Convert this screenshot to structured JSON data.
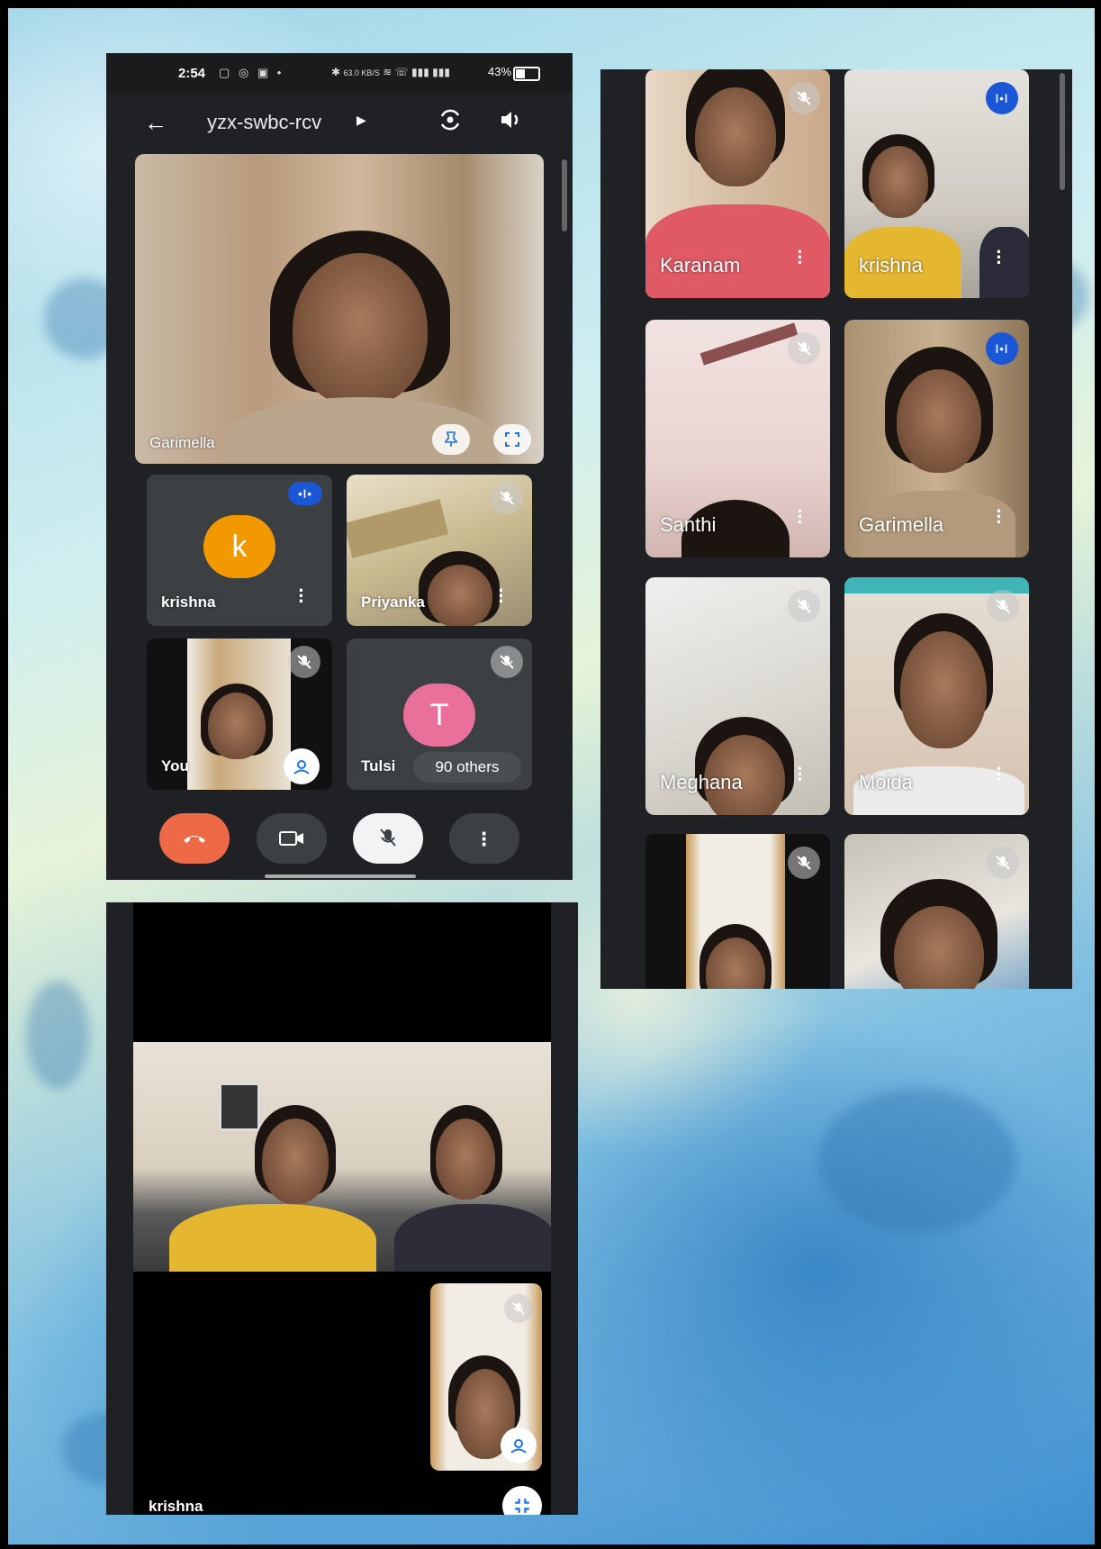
{
  "status_bar": {
    "time": "2:54",
    "data_speed": "63.0 KB/S",
    "battery": "43%"
  },
  "meeting": {
    "code": "yzx-swbc-rcv"
  },
  "phone1": {
    "main_tile_name": "Garimella",
    "tiles": [
      {
        "name": "krishna",
        "avatar_letter": "k",
        "avatar_color": "#f29900"
      },
      {
        "name": "Priyanka"
      },
      {
        "name": "You"
      },
      {
        "name": "Tulsi",
        "avatar_letter": "T",
        "avatar_color": "#e8709b",
        "others": "90 others"
      }
    ]
  },
  "phone2": {
    "tiles": [
      {
        "name": "Karanam"
      },
      {
        "name": "krishna"
      },
      {
        "name": "Santhi"
      },
      {
        "name": "Garimella"
      },
      {
        "name": "Meghana"
      },
      {
        "name": "Moida"
      }
    ]
  },
  "phone3": {
    "name": "krishna"
  },
  "colors": {
    "end_call": "#ee6a46",
    "speaking": "#1a56d6",
    "ui_dark": "#202124"
  },
  "icons": [
    "back-arrow-icon",
    "switch-camera-icon",
    "speaker-icon",
    "pin-icon",
    "fullscreen-icon",
    "mic-off-icon",
    "speaking-icon",
    "more-vert-icon",
    "end-call-icon",
    "camera-icon",
    "chevron-right-icon"
  ]
}
